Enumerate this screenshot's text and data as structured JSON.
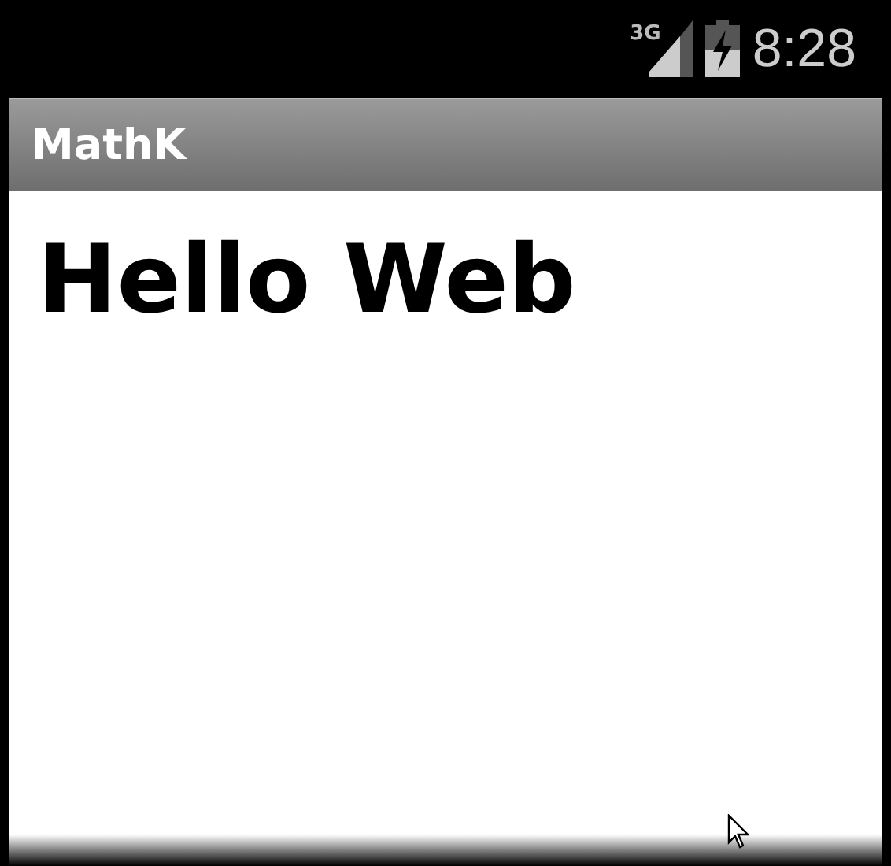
{
  "status_bar": {
    "network": "3G",
    "time": "8:28"
  },
  "action_bar": {
    "title": "MathK"
  },
  "content": {
    "heading": "Hello Web"
  }
}
